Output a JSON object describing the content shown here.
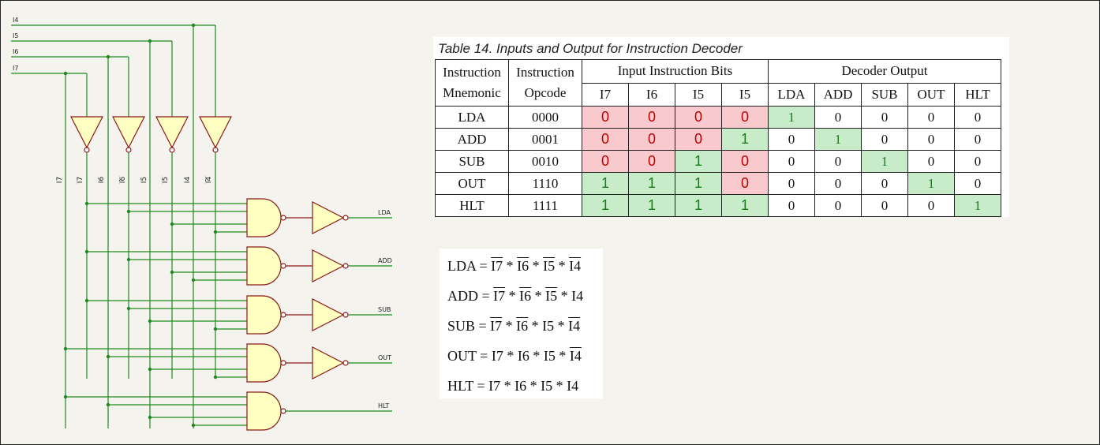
{
  "circuit": {
    "inputs": [
      "I4",
      "I5",
      "I6",
      "I7"
    ],
    "vertical_labels": [
      "I7",
      "I7",
      "I6",
      "I6",
      "I5",
      "I5",
      "I4",
      "I4"
    ],
    "vertical_labels_inverted": [
      false,
      true,
      false,
      true,
      false,
      true,
      false,
      true
    ],
    "outputs": [
      "LDA",
      "ADD",
      "SUB",
      "OUT",
      "HLT"
    ],
    "wire_color": "#1f8a1f",
    "gate_stroke": "#8b1a1a",
    "gate_fill": "#ffffc2"
  },
  "table": {
    "caption": "Table 14. Inputs and Output for Instruction Decoder",
    "header": {
      "col1_line1": "Instruction",
      "col1_line2": "Mnemonic",
      "col2_line1": "Instruction",
      "col2_line2": "Opcode",
      "group1": "Input Instruction Bits",
      "group2": "Decoder Output"
    },
    "bit_columns": [
      "I7",
      "I6",
      "I5",
      "I5"
    ],
    "output_columns": [
      "LDA",
      "ADD",
      "SUB",
      "OUT",
      "HLT"
    ],
    "rows": [
      {
        "mnemonic": "LDA",
        "opcode": "0000",
        "bits": [
          "0",
          "0",
          "0",
          "0"
        ],
        "outputs": [
          "1",
          "0",
          "0",
          "0",
          "0"
        ]
      },
      {
        "mnemonic": "ADD",
        "opcode": "0001",
        "bits": [
          "0",
          "0",
          "0",
          "1"
        ],
        "outputs": [
          "0",
          "1",
          "0",
          "0",
          "0"
        ]
      },
      {
        "mnemonic": "SUB",
        "opcode": "0010",
        "bits": [
          "0",
          "0",
          "1",
          "0"
        ],
        "outputs": [
          "0",
          "0",
          "1",
          "0",
          "0"
        ]
      },
      {
        "mnemonic": "OUT",
        "opcode": "1110",
        "bits": [
          "1",
          "1",
          "1",
          "0"
        ],
        "outputs": [
          "0",
          "0",
          "0",
          "1",
          "0"
        ]
      },
      {
        "mnemonic": "HLT",
        "opcode": "1111",
        "bits": [
          "1",
          "1",
          "1",
          "1"
        ],
        "outputs": [
          "0",
          "0",
          "0",
          "0",
          "1"
        ]
      }
    ],
    "colors": {
      "zero_bg": "#f9cacd",
      "zero_text": "#c00000",
      "one_bg": "#c8ecc9",
      "one_text": "#1a7a1a"
    }
  },
  "equations": [
    {
      "name": "LDA",
      "terms": [
        {
          "t": "I7",
          "bar": true
        },
        {
          "t": "I6",
          "bar": true
        },
        {
          "t": "I5",
          "bar": true
        },
        {
          "t": "I4",
          "bar": true
        }
      ]
    },
    {
      "name": "ADD",
      "terms": [
        {
          "t": "I7",
          "bar": true
        },
        {
          "t": "I6",
          "bar": true
        },
        {
          "t": "I5",
          "bar": true
        },
        {
          "t": "I4",
          "bar": false
        }
      ]
    },
    {
      "name": "SUB",
      "terms": [
        {
          "t": "I7",
          "bar": true
        },
        {
          "t": "I6",
          "bar": true
        },
        {
          "t": "I5",
          "bar": false
        },
        {
          "t": "I4",
          "bar": true
        }
      ]
    },
    {
      "name": "OUT",
      "terms": [
        {
          "t": "I7",
          "bar": false
        },
        {
          "t": "I6",
          "bar": false
        },
        {
          "t": "I5",
          "bar": false
        },
        {
          "t": "I4",
          "bar": true
        }
      ]
    },
    {
      "name": "HLT",
      "terms": [
        {
          "t": "I7",
          "bar": false
        },
        {
          "t": "I6",
          "bar": false
        },
        {
          "t": "I5",
          "bar": false
        },
        {
          "t": "I4",
          "bar": false
        }
      ]
    }
  ]
}
